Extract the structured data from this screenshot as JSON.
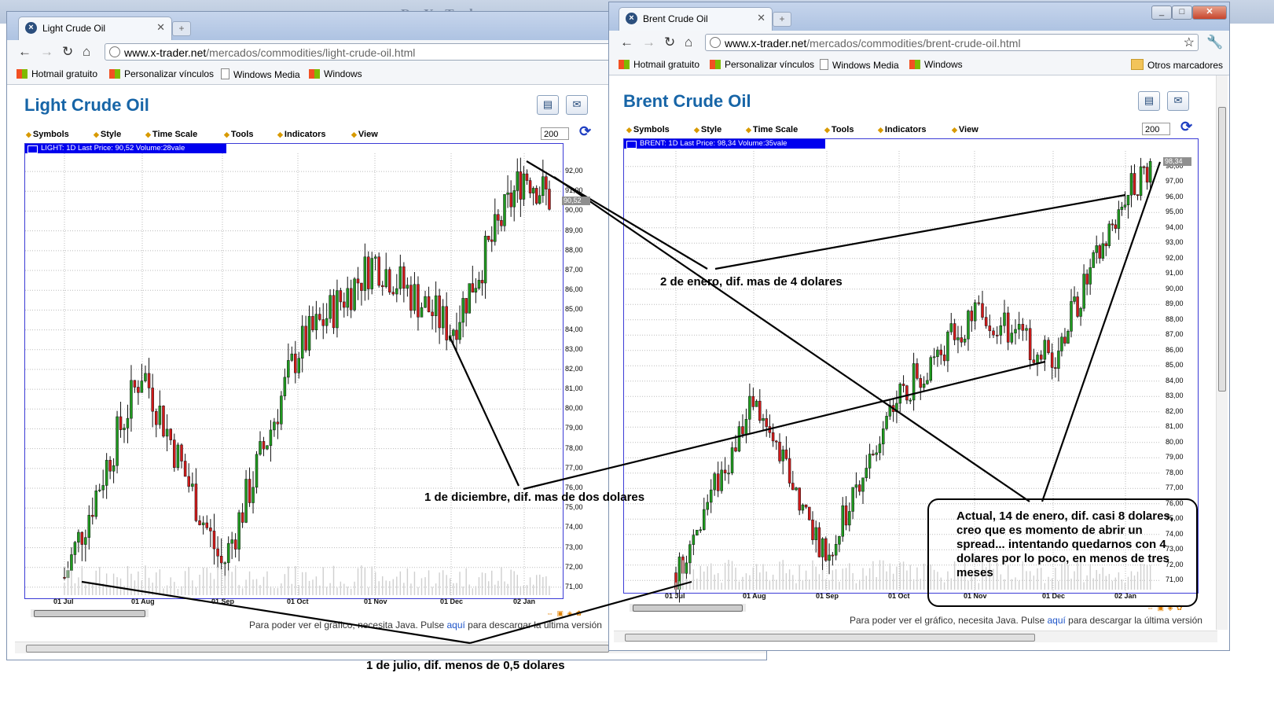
{
  "background": {
    "texts": [
      "Re: Yo, Trader"
    ]
  },
  "windows": [
    {
      "tab_title": "Light Crude Oil",
      "url_host": "www.x-trader.net",
      "url_path": "/mercados/commodities/light-crude-oil.html",
      "bookmarks": [
        "Hotmail gratuito",
        "Personalizar vínculos",
        "Windows Media",
        "Windows"
      ],
      "page_title": "Light Crude Oil",
      "menu": [
        "Symbols",
        "Style",
        "Time Scale",
        "Tools",
        "Indicators",
        "View"
      ],
      "count_value": "200",
      "info_bar": "LIGHT: 1D Last Price: 90,52 Volume:28vale",
      "last_price": "90,52",
      "y_labels": [
        "92,00",
        "91,00",
        "90,00",
        "89,00",
        "88,00",
        "87,00",
        "86,00",
        "85,00",
        "84,00",
        "83,00",
        "82,00",
        "81,00",
        "80,00",
        "79,00",
        "78,00",
        "77,00",
        "76,00",
        "75,00",
        "74,00",
        "73,00",
        "72,00",
        "71,00"
      ],
      "y_range": [
        70.6,
        92.6
      ],
      "x_labels": [
        "01 Jul",
        "01 Aug",
        "01 Sep",
        "01 Oct",
        "01 Nov",
        "01 Dec",
        "02 Jan"
      ],
      "java_msg_before": "Para poder ver el gráfico, necesita Java. Pulse ",
      "java_link": "aquí",
      "java_msg_after": " para descargar la última versión"
    },
    {
      "tab_title": "Brent Crude Oil",
      "url_host": "www.x-trader.net",
      "url_path": "/mercados/commodities/brent-crude-oil.html",
      "bookmarks": [
        "Hotmail gratuito",
        "Personalizar vínculos",
        "Windows Media",
        "Windows"
      ],
      "other_bookmarks": "Otros marcadores",
      "page_title": "Brent Crude Oil",
      "menu": [
        "Symbols",
        "Style",
        "Time Scale",
        "Tools",
        "Indicators",
        "View"
      ],
      "count_value": "200",
      "info_bar": "BRENT: 1D Last Price: 98,34 Volume:35vale",
      "last_price": "98,34",
      "y_labels": [
        "98,00",
        "97,00",
        "96,00",
        "95,00",
        "94,00",
        "93,00",
        "92,00",
        "91,00",
        "90,00",
        "89,00",
        "88,00",
        "87,00",
        "86,00",
        "85,00",
        "84,00",
        "83,00",
        "82,00",
        "81,00",
        "80,00",
        "79,00",
        "78,00",
        "77,00",
        "76,00",
        "75,00",
        "74,00",
        "73,00",
        "72,00",
        "71,00"
      ],
      "y_range": [
        70.4,
        98.6
      ],
      "x_labels": [
        "01 Jul",
        "01 Aug",
        "01 Sep",
        "01 Oct",
        "01 Nov",
        "01 Dec",
        "02 Jan"
      ],
      "java_msg_before": "Para poder ver el gráfico, necesita Java. Pulse ",
      "java_link": "aquí",
      "java_msg_after": " para descargar la última versión"
    }
  ],
  "annotations": {
    "jan2": "2 de enero, dif. mas de 4 dolares",
    "dec1": "1 de diciembre, dif. mas de dos dolares",
    "jul1": "1 de julio, dif. menos de 0,5 dolares",
    "actual": "Actual, 14 de enero, dif. casi 8 dolares, creo que es momento de abrir un spread... intentando quedarnos con 4 dolares por lo poco, en menos de tres meses"
  },
  "chart_data": [
    {
      "type": "candlestick",
      "title": "LIGHT: 1D",
      "ylim": [
        70.6,
        92.6
      ],
      "key_points": [
        {
          "x": "01 Jul",
          "y": 71.5
        },
        {
          "x": "01 Aug",
          "y": 82.0
        },
        {
          "x": "01 Sep",
          "y": 72.0
        },
        {
          "x": "01 Oct",
          "y": 83.0
        },
        {
          "x": "01 Nov",
          "y": 87.5
        },
        {
          "x": "01 Dec",
          "y": 84.0
        },
        {
          "x": "02 Jan",
          "y": 92.0
        },
        {
          "x": "14 Jan",
          "y": 90.52
        }
      ]
    },
    {
      "type": "candlestick",
      "title": "BRENT: 1D",
      "ylim": [
        70.4,
        98.6
      ],
      "key_points": [
        {
          "x": "01 Jul",
          "y": 71.5
        },
        {
          "x": "01 Aug",
          "y": 82.5
        },
        {
          "x": "01 Sep",
          "y": 72.5
        },
        {
          "x": "01 Oct",
          "y": 83.0
        },
        {
          "x": "01 Nov",
          "y": 88.5
        },
        {
          "x": "01 Dec",
          "y": 85.5
        },
        {
          "x": "02 Jan",
          "y": 96.0
        },
        {
          "x": "14 Jan",
          "y": 98.34
        }
      ]
    }
  ]
}
